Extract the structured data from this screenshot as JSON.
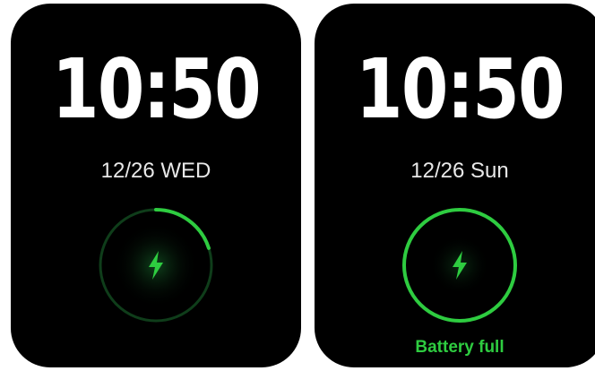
{
  "colors": {
    "screen_bg": "#000000",
    "time_text": "#ffffff",
    "accent_green": "#2ecc40",
    "ring_track": "#0f3d1a"
  },
  "screens": [
    {
      "time": "10:50",
      "date": "12/26 WED",
      "charge_icon": "lightning-bolt-icon",
      "charge_progress": 0.2,
      "status": ""
    },
    {
      "time": "10:50",
      "date": "12/26 Sun",
      "charge_icon": "lightning-bolt-icon",
      "charge_progress": 1.0,
      "status": "Battery full"
    }
  ]
}
